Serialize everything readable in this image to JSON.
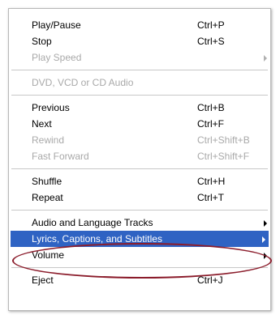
{
  "menu": {
    "groups": [
      [
        {
          "label": "Play/Pause",
          "shortcut": "Ctrl+P",
          "enabled": true
        },
        {
          "label": "Stop",
          "shortcut": "Ctrl+S",
          "enabled": true
        },
        {
          "label": "Play Speed",
          "shortcut": "",
          "enabled": false,
          "submenu": true
        }
      ],
      [
        {
          "label": "DVD, VCD or CD Audio",
          "shortcut": "",
          "enabled": false
        }
      ],
      [
        {
          "label": "Previous",
          "shortcut": "Ctrl+B",
          "enabled": true
        },
        {
          "label": "Next",
          "shortcut": "Ctrl+F",
          "enabled": true
        },
        {
          "label": "Rewind",
          "shortcut": "Ctrl+Shift+B",
          "enabled": false
        },
        {
          "label": "Fast Forward",
          "shortcut": "Ctrl+Shift+F",
          "enabled": false
        }
      ],
      [
        {
          "label": "Shuffle",
          "shortcut": "Ctrl+H",
          "enabled": true
        },
        {
          "label": "Repeat",
          "shortcut": "Ctrl+T",
          "enabled": true
        }
      ],
      [
        {
          "label": "Audio and Language Tracks",
          "shortcut": "",
          "enabled": true,
          "submenu": true
        },
        {
          "label": "Lyrics, Captions, and Subtitles",
          "shortcut": "",
          "enabled": true,
          "submenu": true,
          "selected": true
        },
        {
          "label": "Volume",
          "shortcut": "",
          "enabled": true,
          "submenu": true
        }
      ],
      [
        {
          "label": "Eject",
          "shortcut": "Ctrl+J",
          "enabled": true
        }
      ]
    ],
    "selected_color": "#2f63c3",
    "disabled_color": "#a9a9a9",
    "annotation_color": "#8b1c2b"
  }
}
